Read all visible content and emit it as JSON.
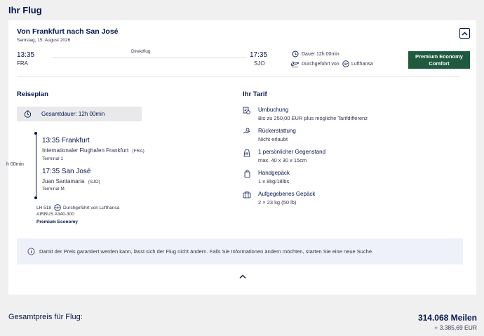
{
  "section_title": "Ihr Flug",
  "flight": {
    "route_title": "Von Frankfurt nach San José",
    "date": "Samstag, 15. August 2026",
    "dep_time": "13:35",
    "dep_code": "FRA",
    "direct_label": "Direktflug",
    "arr_time": "17:35",
    "arr_code": "SJO",
    "duration": "Dauer 12h 00min",
    "operated_by": "Durchgeführt von",
    "airline": "Lufthansa",
    "fare_badge_line1": "Premium Economy",
    "fare_badge_line2": "Comfort"
  },
  "itinerary": {
    "heading": "Reiseplan",
    "total_duration": "Gesamtdauer: 12h 00min",
    "segment_duration_clip": "h 00min",
    "dep_time_city": "13:35 Frankfurt",
    "dep_airport": "Internationaler Flughafen Frankfurt",
    "dep_airport_code": "(FRA)",
    "dep_terminal": "Terminal 1",
    "arr_time_city": "17:35 San José",
    "arr_airport": "Juan Santamaria",
    "arr_airport_code": "(SJO)",
    "arr_terminal": "Terminal M",
    "flight_no": "LH 518",
    "operated_by": "Durchgeführt von Lufthansa",
    "aircraft": "AIRBUS A340-300",
    "cabin": "Premium Economy"
  },
  "tarif": {
    "heading": "Ihr Tarif",
    "items": [
      {
        "icon": "rebooking-icon",
        "title": "Umbuchung",
        "sub": "Bis zu 250,00 EUR plus mögliche Tarifdifferenz"
      },
      {
        "icon": "refund-icon",
        "title": "Rückerstattung",
        "sub": "Nicht erlaubt"
      },
      {
        "icon": "personal-item-icon",
        "title": "1 persönlicher Gegenstand",
        "sub": "max. 40 x 30 x 15cm"
      },
      {
        "icon": "hand-baggage-icon",
        "title": "Handgepäck",
        "sub": "1 x 8kg/18lbs"
      },
      {
        "icon": "checked-baggage-icon",
        "title": "Aufgegebenes Gepäck",
        "sub": "2 × 23 kg (50 lb)"
      }
    ]
  },
  "info_message": "Damit der Preis garantiert werden kann, lässt sich der Flug nicht ändern. Falls Sie Informationen ändern möchten, starten Sie eine neue Suche.",
  "total": {
    "label": "Gesamtpreis für Flug:",
    "miles": "314.068 Meilen",
    "eur": "+ 3.385,69 EUR"
  },
  "colors": {
    "brand_navy": "#05164d",
    "fare_badge": "#1f5a3f",
    "info_bg": "#eef1f9"
  }
}
